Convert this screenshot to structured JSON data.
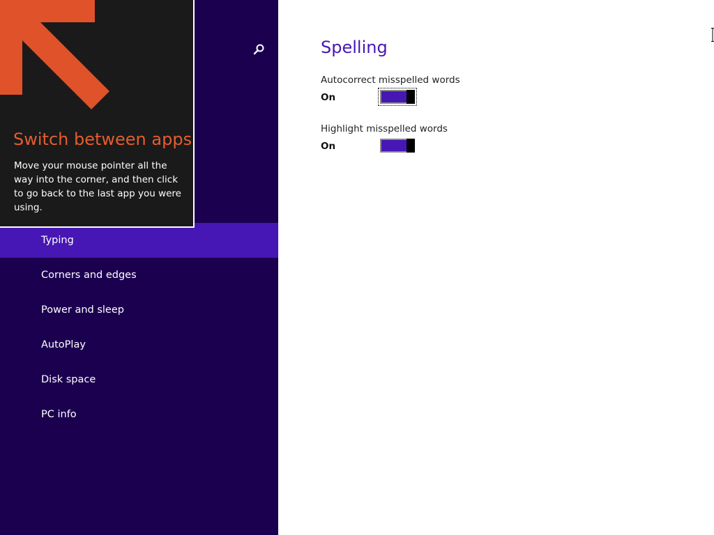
{
  "tip": {
    "title": "Switch between apps",
    "body": "Move your mouse pointer all the way into the corner, and then click to go back to the last app you were using."
  },
  "nav": {
    "search_icon": "search-icon",
    "items": [
      {
        "label": "Typing",
        "selected": true
      },
      {
        "label": "Corners and edges",
        "selected": false
      },
      {
        "label": "Power and sleep",
        "selected": false
      },
      {
        "label": "AutoPlay",
        "selected": false
      },
      {
        "label": "Disk space",
        "selected": false
      },
      {
        "label": "PC info",
        "selected": false
      }
    ]
  },
  "content": {
    "section_title": "Spelling",
    "settings": [
      {
        "label": "Autocorrect misspelled words",
        "state": "On"
      },
      {
        "label": "Highlight misspelled words",
        "state": "On"
      }
    ]
  },
  "colors": {
    "nav_bg": "#1c0050",
    "accent": "#4617b4",
    "tip_title": "#e45d2f",
    "tip_arrow": "#e0522a"
  }
}
